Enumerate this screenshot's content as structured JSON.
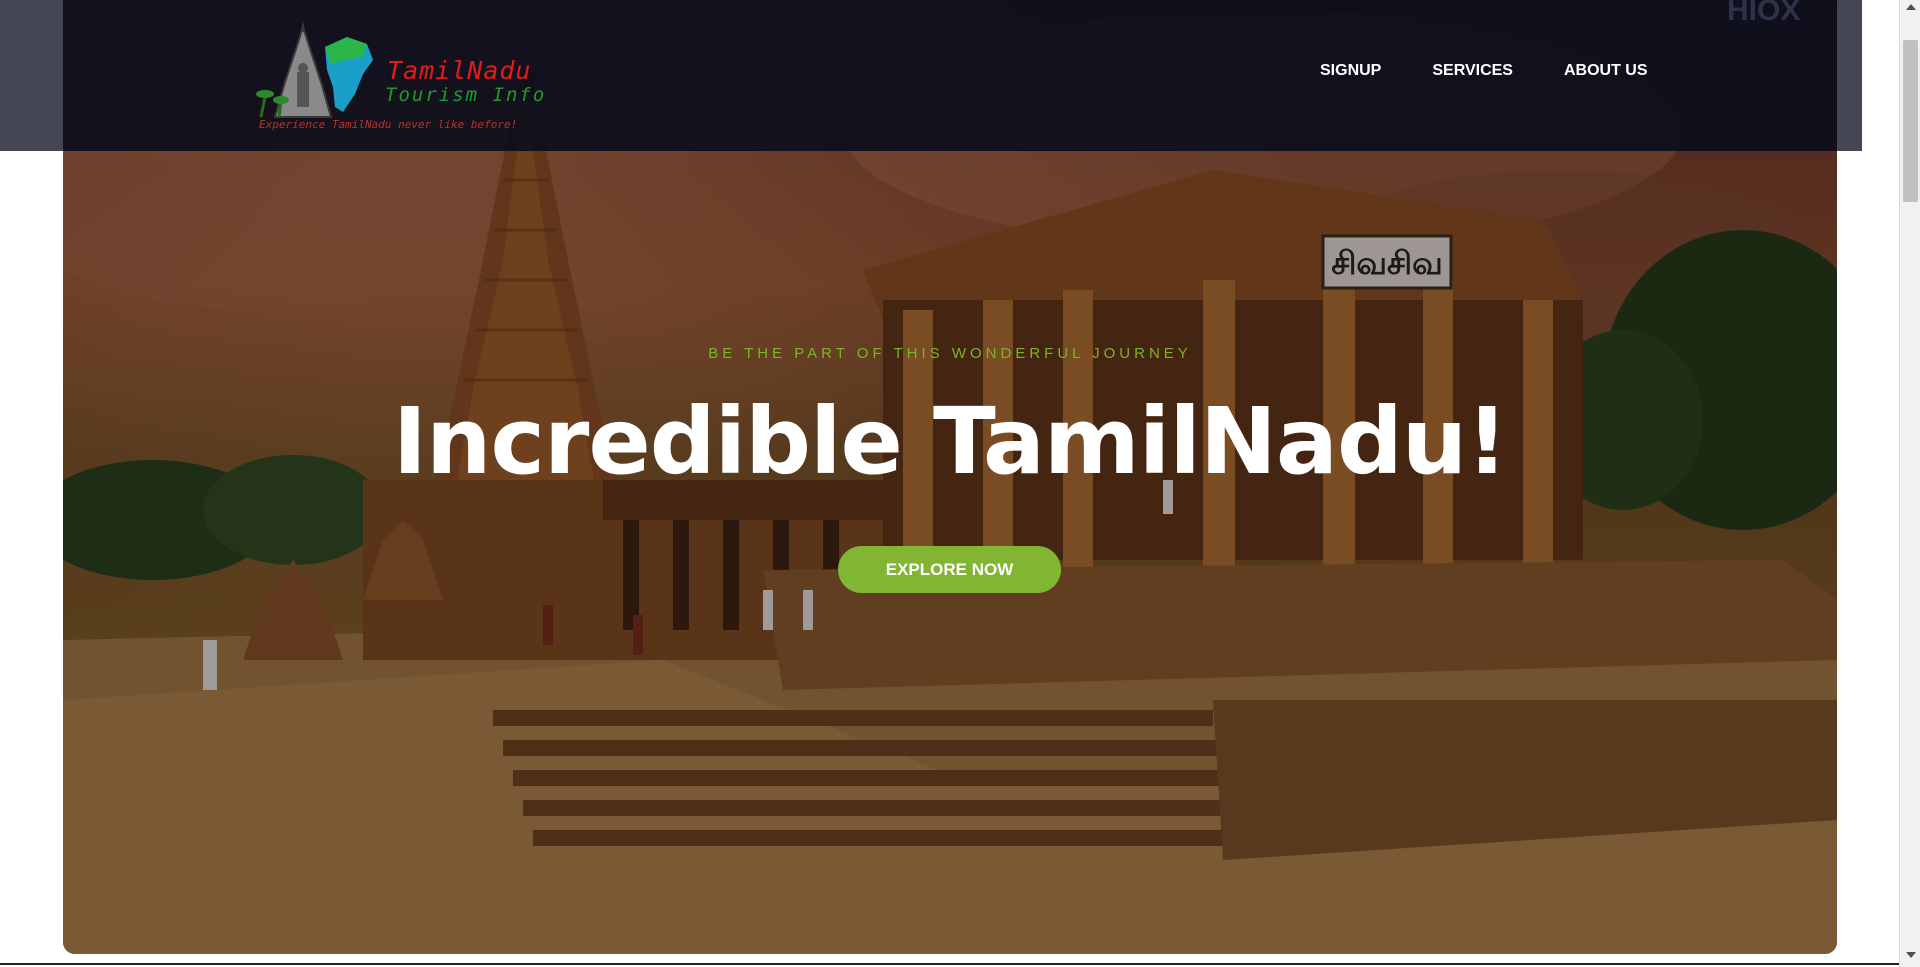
{
  "navbar": {
    "logo": {
      "title": "TamilNadu",
      "subtitle": "Tourism Info",
      "tagline": "Experience TamilNadu never like before!"
    },
    "links": [
      {
        "label": "SIGNUP"
      },
      {
        "label": "SERVICES"
      },
      {
        "label": "ABOUT US"
      }
    ]
  },
  "watermark": "HIOX",
  "hero": {
    "kicker": "BE THE PART OF THIS WONDERFUL JOURNEY",
    "headline": "Incredible TamilNadu!",
    "cta_label": "EXPLORE NOW",
    "signboard_text": "சிவசிவ"
  },
  "colors": {
    "accent": "#82b532",
    "kicker": "#7fb32a",
    "nav_bg": "#10122a",
    "logo_title": "#e51b1b",
    "logo_subtitle": "#1f9a2a"
  }
}
